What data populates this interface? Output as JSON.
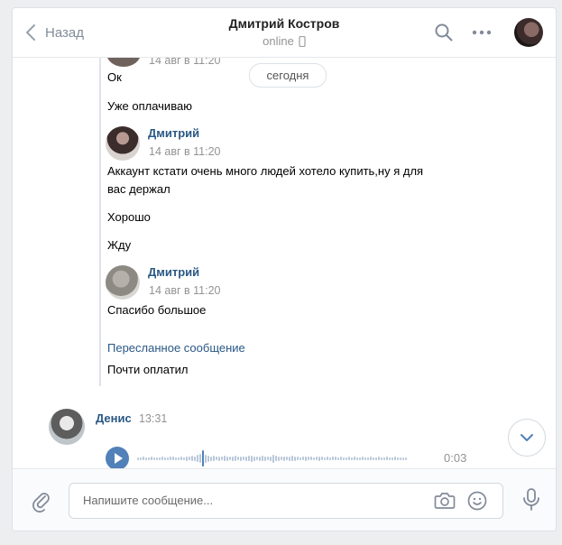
{
  "header": {
    "back_label": "Назад",
    "title": "Дмитрий Костров",
    "status": "online"
  },
  "history": {
    "date_pill": "сегодня",
    "top_time": "14 авг в 11:20",
    "messages_1": [
      "Ок",
      "Уже оплачиваю"
    ],
    "block_2": {
      "author": "Дмитрий",
      "time": "14 авг в 11:20",
      "text_line1": "Аккаунт кстати очень много людей хотело купить,ну я для",
      "text_line2": "вас держал",
      "more": [
        "Хорошо",
        "Жду"
      ]
    },
    "block_3": {
      "author": "Дмитрий",
      "time": "14 авг в 11:20",
      "text": "Спасибо большое"
    },
    "forwarded_label": "Пересланное сообщение",
    "after_forward": "Почти оплатил",
    "own": {
      "author": "Денис",
      "time": "13:31",
      "voice_duration": "0:03"
    }
  },
  "composer": {
    "placeholder": "Напишите сообщение..."
  },
  "icons": {
    "back": "chevron-left-icon",
    "search": "search-icon",
    "more": "more-icon",
    "phone": "mobile-phone-icon",
    "play": "play-icon",
    "scroll_down": "chevron-down-icon",
    "attach": "paperclip-icon",
    "camera": "camera-icon",
    "emoji": "smile-icon",
    "mic": "microphone-icon"
  },
  "colors": {
    "accent": "#5181b8",
    "link": "#2a5885",
    "muted": "#939393"
  }
}
